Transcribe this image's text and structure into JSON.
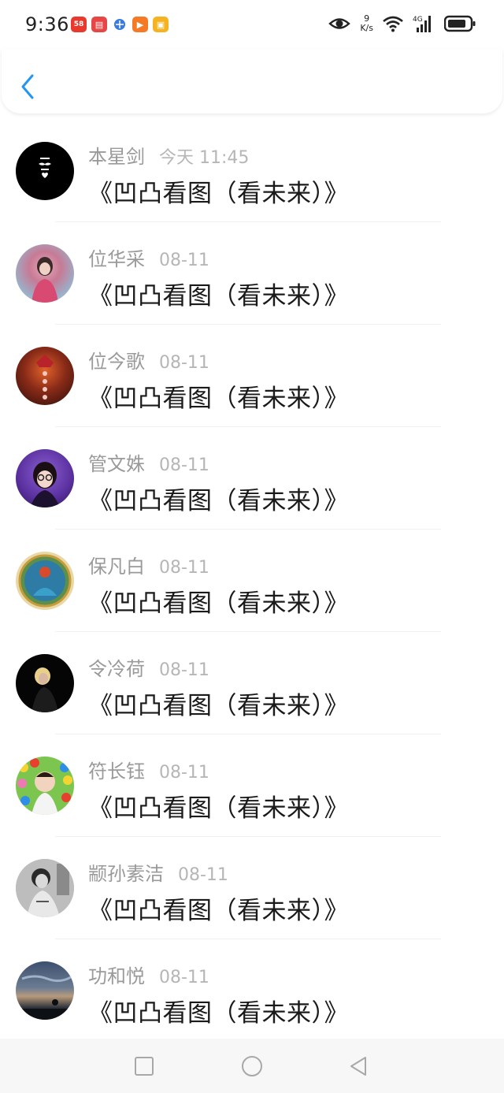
{
  "status_bar": {
    "time": "9:36",
    "net_speed_value": "9",
    "net_speed_unit": "K/s",
    "network_type": "4G",
    "app_icons": [
      {
        "name": "app-icon-1",
        "color": "#e8392c",
        "glyph": "58"
      },
      {
        "name": "app-icon-2",
        "color": "#e84545",
        "glyph": "▤"
      },
      {
        "name": "app-icon-3",
        "color": "#3a7be0",
        "glyph": "●"
      },
      {
        "name": "app-icon-4",
        "color": "#f47a26",
        "glyph": "▶"
      },
      {
        "name": "app-icon-5",
        "color": "#f5b321",
        "glyph": "▣"
      }
    ]
  },
  "header": {
    "back_icon": "chevron-left-icon",
    "accent": "#2196f3"
  },
  "items": [
    {
      "name": "本星剑",
      "date": "今天 11:45",
      "message": "《凹凸看图（看未来）》"
    },
    {
      "name": "位华采",
      "date": "08-11",
      "message": "《凹凸看图（看未来）》"
    },
    {
      "name": "位今歌",
      "date": "08-11",
      "message": "《凹凸看图（看未来）》"
    },
    {
      "name": "管文姝",
      "date": "08-11",
      "message": "《凹凸看图（看未来）》"
    },
    {
      "name": "保凡白",
      "date": "08-11",
      "message": "《凹凸看图（看未来）》"
    },
    {
      "name": "令冷荷",
      "date": "08-11",
      "message": "《凹凸看图（看未来）》"
    },
    {
      "name": "符长钰",
      "date": "08-11",
      "message": "《凹凸看图（看未来）》"
    },
    {
      "name": "颛孙素洁",
      "date": "08-11",
      "message": "《凹凸看图（看未来）》"
    },
    {
      "name": "功和悦",
      "date": "08-11",
      "message": "《凹凸看图（看未来）》"
    }
  ],
  "nav_bar": {
    "recent_icon": "square-icon",
    "home_icon": "circle-icon",
    "back_icon": "triangle-back-icon"
  }
}
